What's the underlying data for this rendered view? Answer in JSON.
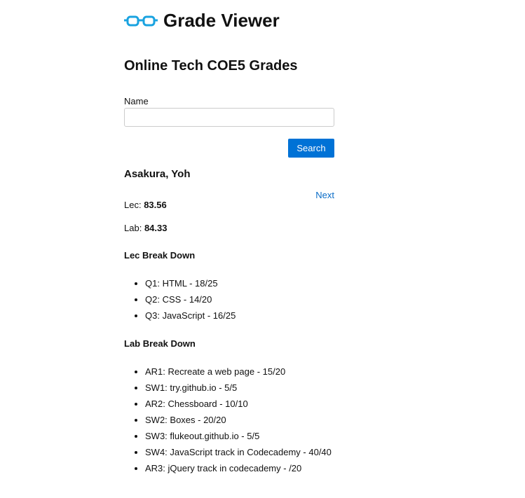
{
  "header": {
    "app_title": "Grade Viewer",
    "logo_icon": "glasses-icon",
    "accent_color": "#1aa3e0"
  },
  "course": {
    "title": "Online Tech COE5 Grades"
  },
  "search": {
    "label": "Name",
    "value": "",
    "placeholder": "",
    "button_label": "Search",
    "button_color": "#0072d6"
  },
  "student": {
    "name": "Asakura, Yoh",
    "next_label": "Next",
    "lec_label": "Lec:",
    "lec_value": "83.56",
    "lab_label": "Lab:",
    "lab_value": "84.33"
  },
  "lec_breakdown": {
    "heading": "Lec Break Down",
    "items": [
      "Q1: HTML - 18/25",
      "Q2: CSS - 14/20",
      "Q3: JavaScript - 16/25"
    ]
  },
  "lab_breakdown": {
    "heading": "Lab Break Down",
    "items": [
      "AR1: Recreate a web page - 15/20",
      "SW1: try.github.io - 5/5",
      "AR2: Chessboard - 10/10",
      "SW2: Boxes - 20/20",
      "SW3: flukeout.github.io - 5/5",
      "SW4: JavaScript track in Codecademy - 40/40",
      "AR3: jQuery track in codecademy - /20"
    ]
  }
}
